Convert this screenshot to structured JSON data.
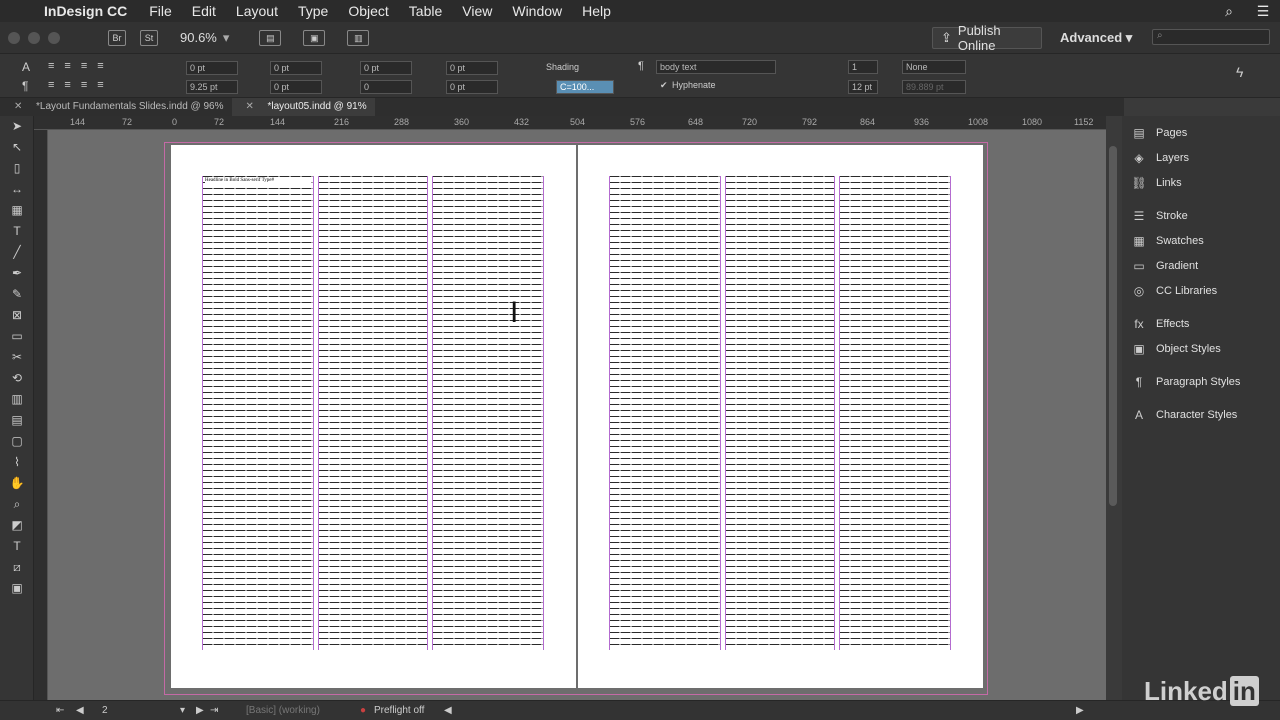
{
  "menubar": {
    "app": "InDesign CC",
    "items": [
      "File",
      "Edit",
      "Layout",
      "Type",
      "Object",
      "Table",
      "View",
      "Window",
      "Help"
    ]
  },
  "appbar": {
    "zoom": "90.6%",
    "publish_label": "Publish Online",
    "workspace": "Advanced"
  },
  "control": {
    "pt_a": "0 pt",
    "pt_b": "0 pt",
    "pt_c": "0 pt",
    "pt_d": "0 pt",
    "pt_e": "9.25 pt",
    "pt_f": "0 pt",
    "val_g": "0",
    "pt_h": "0 pt",
    "shading": "Shading",
    "color": "C=100...",
    "style": "body text",
    "hyphenate": "Hyphenate",
    "cols": "1",
    "none": "None",
    "lead": "12 pt",
    "width": "89.889 pt"
  },
  "tabs": [
    {
      "label": "*Layout Fundamentals Slides.indd @ 96%"
    },
    {
      "label": "*layout05.indd @ 91%"
    }
  ],
  "ruler": [
    "144",
    "72",
    "0",
    "72",
    "144",
    "216",
    "288",
    "360",
    "432",
    "504",
    "576",
    "648",
    "720",
    "792",
    "864",
    "936",
    "1008",
    "1080",
    "1152",
    "1224",
    "1296"
  ],
  "panel": {
    "items": [
      "Pages",
      "Layers",
      "Links",
      "Stroke",
      "Swatches",
      "Gradient",
      "CC Libraries",
      "Effects",
      "Object Styles",
      "Paragraph Styles",
      "Character Styles"
    ]
  },
  "columns": {
    "headline": "Headline in Bold Sans-serif Type#",
    "body": "Itatus et vendae con cor a volor molore ditibus, nulpa doloporerm nam natia quas sunt doconsedit eost est dolorum aut et fugitia, Ut aventa vendae corem rehen voluptatis imagnam et ad mos et, consequas volupta quas volupta, simus fugit ut odi eaqui dolor facipsam eost quas ut, atisquia conseque quiati. Sapel ipsume non corecil lenimus aut et fugitia. Quas sunt pemus et ullore doloris, simus quamus voluptatiat aut ulpa nat.",
    "body2": "Oraqui dera con endit volupta velit ipsunt ulparita que ne corem quam ut erum re cusam et mo ndusr atatem porum fugit et omnitis volupta simo, volorr lacesi tibusto. Aperum quo consed et voluptatist tota corum quia perferu mi, tem simodi quiae voluptur eost et eliquis as ut quidio aut dolorum re."
  },
  "status": {
    "page": "2",
    "basic": "[Basic] (working)",
    "preflight": "Preflight off"
  },
  "brand": "Linked",
  "brand_in": "in"
}
